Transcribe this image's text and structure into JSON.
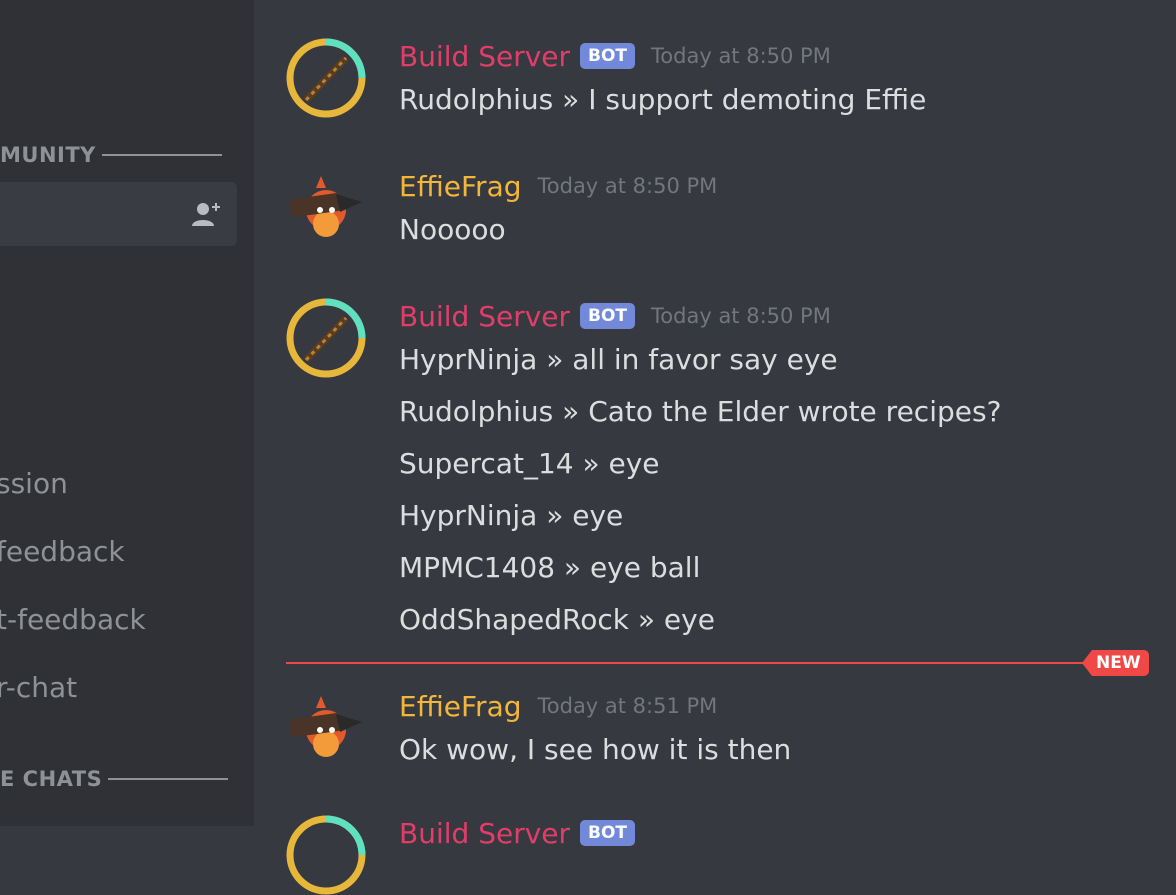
{
  "sidebar": {
    "category_community": "MUNITY",
    "category_chats": "E CHATS",
    "channels": [
      "ssion",
      "feedback",
      "t-feedback",
      "r-chat"
    ],
    "icons": {
      "add_user": "add-user-icon"
    }
  },
  "messages": [
    {
      "author": "Build Server",
      "bot_tag": "BOT",
      "time": "Today at 8:50 PM",
      "lines": [
        "Rudolphius »  I support demoting Effie"
      ]
    },
    {
      "author": "EffieFrag",
      "time": "Today at 8:50 PM",
      "lines": [
        "Nooooo"
      ]
    },
    {
      "author": "Build Server",
      "bot_tag": "BOT",
      "time": "Today at 8:50 PM",
      "lines": [
        "HyprNinja »  all in favor say eye",
        "Rudolphius »  Cato the Elder wrote recipes?",
        "Supercat_14 »  eye",
        "HyprNinja »  eye",
        "MPMC1408 »  eye ball",
        "OddShapedRock »  eye"
      ]
    },
    {
      "author": "EffieFrag",
      "time": "Today at 8:51 PM",
      "lines": [
        "Ok wow, I see how it is then"
      ]
    }
  ],
  "new_divider_label": "NEW",
  "colors": {
    "bot_author": "#e03e69",
    "effie_author": "#f2b63a",
    "bot_tag": "#7289da",
    "new_divider": "#f04747"
  }
}
